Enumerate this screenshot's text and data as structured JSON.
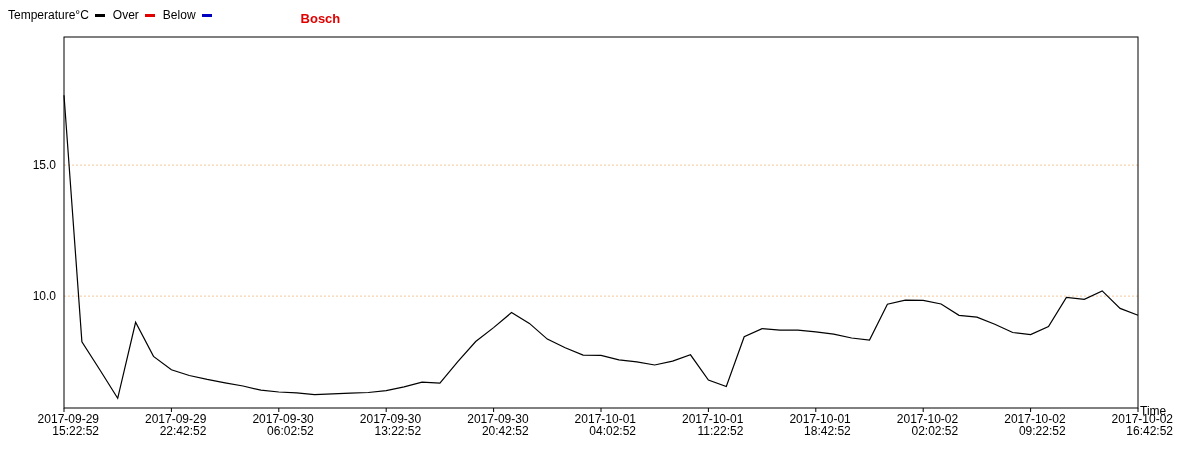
{
  "legend": [
    {
      "label": "Over",
      "color": "#e00000"
    },
    {
      "label": "Below",
      "color": "#0000c0"
    }
  ],
  "chart_data": {
    "type": "line",
    "title": "Bosch",
    "xlabel": "Time",
    "ylim": [
      5.73,
      19.89
    ],
    "yticks": [
      {
        "value": 10,
        "label": "10.0"
      },
      {
        "value": 15,
        "label": "15.0"
      }
    ],
    "categories": [
      "2017-09-29 15:22:52",
      null,
      null,
      null,
      null,
      null,
      "2017-09-29 22:42:52",
      null,
      null,
      null,
      null,
      null,
      "2017-09-30 06:02:52",
      null,
      null,
      null,
      null,
      null,
      "2017-09-30 13:22:52",
      null,
      null,
      null,
      null,
      null,
      "2017-09-30 20:42:52",
      null,
      null,
      null,
      null,
      null,
      "2017-10-01 04:02:52",
      null,
      null,
      null,
      null,
      null,
      "2017-10-01 11:22:52",
      null,
      null,
      null,
      null,
      null,
      "2017-10-01 18:42:52",
      null,
      null,
      null,
      null,
      null,
      "2017-10-02 02:02:52",
      null,
      null,
      null,
      null,
      null,
      "2017-10-02 09:22:52",
      null,
      null,
      null,
      null,
      null,
      "2017-10-02 16:42:52"
    ],
    "series": [
      {
        "name": "Temperature°C",
        "color": "#000000",
        "values": [
          17.67,
          8.26,
          7.19,
          6.1,
          9.0,
          7.7,
          7.19,
          6.97,
          6.82,
          6.69,
          6.57,
          6.41,
          6.34,
          6.31,
          6.24,
          6.27,
          6.3,
          6.32,
          6.39,
          6.54,
          6.72,
          6.68,
          7.5,
          8.27,
          8.8,
          9.37,
          8.96,
          8.36,
          8.03,
          7.75,
          7.74,
          7.57,
          7.49,
          7.37,
          7.52,
          7.76,
          6.8,
          6.55,
          8.45,
          8.76,
          8.7,
          8.7,
          8.64,
          8.55,
          8.4,
          8.32,
          9.69,
          9.85,
          9.84,
          9.7,
          9.27,
          9.2,
          8.93,
          8.61,
          8.53,
          8.84,
          9.95,
          9.88,
          10.2,
          9.53,
          9.27
        ]
      }
    ]
  }
}
